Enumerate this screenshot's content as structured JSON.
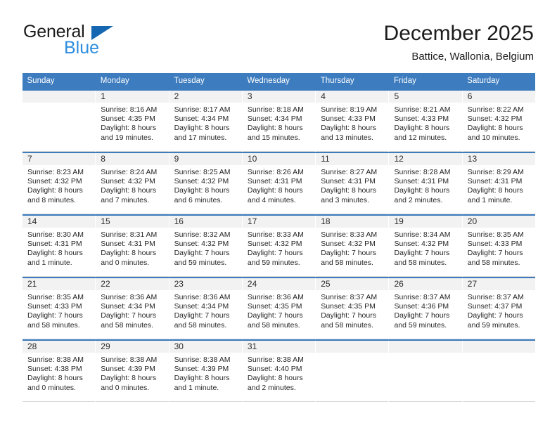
{
  "brand": {
    "name_line1": "General",
    "name_line2": "Blue",
    "triangle_color": "#1667b2",
    "blue_text_color": "#2e8ddf"
  },
  "header": {
    "title": "December 2025",
    "subtitle": "Battice, Wallonia, Belgium",
    "header_bg_color": "#3c7cbf",
    "header_text_color": "#ffffff"
  },
  "weekday_headers": [
    "Sunday",
    "Monday",
    "Tuesday",
    "Wednesday",
    "Thursday",
    "Friday",
    "Saturday"
  ],
  "weeks": [
    [
      {
        "day": "",
        "sunrise": "",
        "sunset": "",
        "daylight_line1": "",
        "daylight_line2": ""
      },
      {
        "day": "1",
        "sunrise": "Sunrise: 8:16 AM",
        "sunset": "Sunset: 4:35 PM",
        "daylight_line1": "Daylight: 8 hours",
        "daylight_line2": "and 19 minutes."
      },
      {
        "day": "2",
        "sunrise": "Sunrise: 8:17 AM",
        "sunset": "Sunset: 4:34 PM",
        "daylight_line1": "Daylight: 8 hours",
        "daylight_line2": "and 17 minutes."
      },
      {
        "day": "3",
        "sunrise": "Sunrise: 8:18 AM",
        "sunset": "Sunset: 4:34 PM",
        "daylight_line1": "Daylight: 8 hours",
        "daylight_line2": "and 15 minutes."
      },
      {
        "day": "4",
        "sunrise": "Sunrise: 8:19 AM",
        "sunset": "Sunset: 4:33 PM",
        "daylight_line1": "Daylight: 8 hours",
        "daylight_line2": "and 13 minutes."
      },
      {
        "day": "5",
        "sunrise": "Sunrise: 8:21 AM",
        "sunset": "Sunset: 4:33 PM",
        "daylight_line1": "Daylight: 8 hours",
        "daylight_line2": "and 12 minutes."
      },
      {
        "day": "6",
        "sunrise": "Sunrise: 8:22 AM",
        "sunset": "Sunset: 4:32 PM",
        "daylight_line1": "Daylight: 8 hours",
        "daylight_line2": "and 10 minutes."
      }
    ],
    [
      {
        "day": "7",
        "sunrise": "Sunrise: 8:23 AM",
        "sunset": "Sunset: 4:32 PM",
        "daylight_line1": "Daylight: 8 hours",
        "daylight_line2": "and 8 minutes."
      },
      {
        "day": "8",
        "sunrise": "Sunrise: 8:24 AM",
        "sunset": "Sunset: 4:32 PM",
        "daylight_line1": "Daylight: 8 hours",
        "daylight_line2": "and 7 minutes."
      },
      {
        "day": "9",
        "sunrise": "Sunrise: 8:25 AM",
        "sunset": "Sunset: 4:32 PM",
        "daylight_line1": "Daylight: 8 hours",
        "daylight_line2": "and 6 minutes."
      },
      {
        "day": "10",
        "sunrise": "Sunrise: 8:26 AM",
        "sunset": "Sunset: 4:31 PM",
        "daylight_line1": "Daylight: 8 hours",
        "daylight_line2": "and 4 minutes."
      },
      {
        "day": "11",
        "sunrise": "Sunrise: 8:27 AM",
        "sunset": "Sunset: 4:31 PM",
        "daylight_line1": "Daylight: 8 hours",
        "daylight_line2": "and 3 minutes."
      },
      {
        "day": "12",
        "sunrise": "Sunrise: 8:28 AM",
        "sunset": "Sunset: 4:31 PM",
        "daylight_line1": "Daylight: 8 hours",
        "daylight_line2": "and 2 minutes."
      },
      {
        "day": "13",
        "sunrise": "Sunrise: 8:29 AM",
        "sunset": "Sunset: 4:31 PM",
        "daylight_line1": "Daylight: 8 hours",
        "daylight_line2": "and 1 minute."
      }
    ],
    [
      {
        "day": "14",
        "sunrise": "Sunrise: 8:30 AM",
        "sunset": "Sunset: 4:31 PM",
        "daylight_line1": "Daylight: 8 hours",
        "daylight_line2": "and 1 minute."
      },
      {
        "day": "15",
        "sunrise": "Sunrise: 8:31 AM",
        "sunset": "Sunset: 4:31 PM",
        "daylight_line1": "Daylight: 8 hours",
        "daylight_line2": "and 0 minutes."
      },
      {
        "day": "16",
        "sunrise": "Sunrise: 8:32 AM",
        "sunset": "Sunset: 4:32 PM",
        "daylight_line1": "Daylight: 7 hours",
        "daylight_line2": "and 59 minutes."
      },
      {
        "day": "17",
        "sunrise": "Sunrise: 8:33 AM",
        "sunset": "Sunset: 4:32 PM",
        "daylight_line1": "Daylight: 7 hours",
        "daylight_line2": "and 59 minutes."
      },
      {
        "day": "18",
        "sunrise": "Sunrise: 8:33 AM",
        "sunset": "Sunset: 4:32 PM",
        "daylight_line1": "Daylight: 7 hours",
        "daylight_line2": "and 58 minutes."
      },
      {
        "day": "19",
        "sunrise": "Sunrise: 8:34 AM",
        "sunset": "Sunset: 4:32 PM",
        "daylight_line1": "Daylight: 7 hours",
        "daylight_line2": "and 58 minutes."
      },
      {
        "day": "20",
        "sunrise": "Sunrise: 8:35 AM",
        "sunset": "Sunset: 4:33 PM",
        "daylight_line1": "Daylight: 7 hours",
        "daylight_line2": "and 58 minutes."
      }
    ],
    [
      {
        "day": "21",
        "sunrise": "Sunrise: 8:35 AM",
        "sunset": "Sunset: 4:33 PM",
        "daylight_line1": "Daylight: 7 hours",
        "daylight_line2": "and 58 minutes."
      },
      {
        "day": "22",
        "sunrise": "Sunrise: 8:36 AM",
        "sunset": "Sunset: 4:34 PM",
        "daylight_line1": "Daylight: 7 hours",
        "daylight_line2": "and 58 minutes."
      },
      {
        "day": "23",
        "sunrise": "Sunrise: 8:36 AM",
        "sunset": "Sunset: 4:34 PM",
        "daylight_line1": "Daylight: 7 hours",
        "daylight_line2": "and 58 minutes."
      },
      {
        "day": "24",
        "sunrise": "Sunrise: 8:36 AM",
        "sunset": "Sunset: 4:35 PM",
        "daylight_line1": "Daylight: 7 hours",
        "daylight_line2": "and 58 minutes."
      },
      {
        "day": "25",
        "sunrise": "Sunrise: 8:37 AM",
        "sunset": "Sunset: 4:35 PM",
        "daylight_line1": "Daylight: 7 hours",
        "daylight_line2": "and 58 minutes."
      },
      {
        "day": "26",
        "sunrise": "Sunrise: 8:37 AM",
        "sunset": "Sunset: 4:36 PM",
        "daylight_line1": "Daylight: 7 hours",
        "daylight_line2": "and 59 minutes."
      },
      {
        "day": "27",
        "sunrise": "Sunrise: 8:37 AM",
        "sunset": "Sunset: 4:37 PM",
        "daylight_line1": "Daylight: 7 hours",
        "daylight_line2": "and 59 minutes."
      }
    ],
    [
      {
        "day": "28",
        "sunrise": "Sunrise: 8:38 AM",
        "sunset": "Sunset: 4:38 PM",
        "daylight_line1": "Daylight: 8 hours",
        "daylight_line2": "and 0 minutes."
      },
      {
        "day": "29",
        "sunrise": "Sunrise: 8:38 AM",
        "sunset": "Sunset: 4:39 PM",
        "daylight_line1": "Daylight: 8 hours",
        "daylight_line2": "and 0 minutes."
      },
      {
        "day": "30",
        "sunrise": "Sunrise: 8:38 AM",
        "sunset": "Sunset: 4:39 PM",
        "daylight_line1": "Daylight: 8 hours",
        "daylight_line2": "and 1 minute."
      },
      {
        "day": "31",
        "sunrise": "Sunrise: 8:38 AM",
        "sunset": "Sunset: 4:40 PM",
        "daylight_line1": "Daylight: 8 hours",
        "daylight_line2": "and 2 minutes."
      },
      {
        "day": "",
        "sunrise": "",
        "sunset": "",
        "daylight_line1": "",
        "daylight_line2": ""
      },
      {
        "day": "",
        "sunrise": "",
        "sunset": "",
        "daylight_line1": "",
        "daylight_line2": ""
      },
      {
        "day": "",
        "sunrise": "",
        "sunset": "",
        "daylight_line1": "",
        "daylight_line2": ""
      }
    ]
  ]
}
